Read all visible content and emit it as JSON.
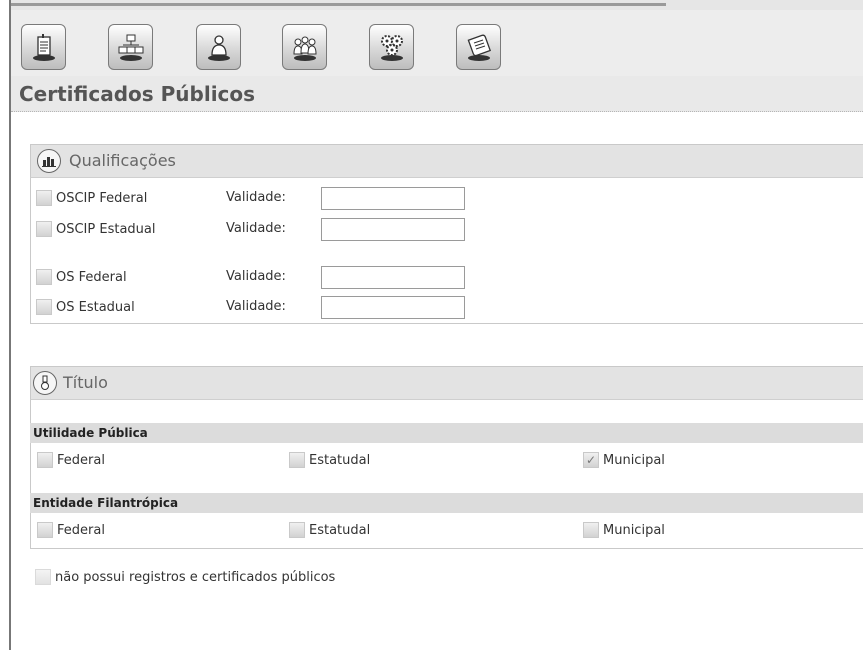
{
  "page": {
    "title": "Certificados Públicos"
  },
  "toolbar": {
    "buttons": [
      {
        "icon": "document-icon"
      },
      {
        "icon": "org-chart-icon"
      },
      {
        "icon": "person-icon"
      },
      {
        "icon": "people-icon"
      },
      {
        "icon": "gears-icon"
      },
      {
        "icon": "certificate-icon"
      }
    ]
  },
  "qualificacoes": {
    "title": "Qualificações",
    "validade_label": "Validade:",
    "items": [
      {
        "label": "OSCIP Federal",
        "checked": false,
        "validade": ""
      },
      {
        "label": "OSCIP Estadual",
        "checked": false,
        "validade": ""
      },
      {
        "label": "OS Federal",
        "checked": false,
        "validade": ""
      },
      {
        "label": "OS Estadual",
        "checked": false,
        "validade": ""
      }
    ]
  },
  "titulo": {
    "title": "Título",
    "utilidade": {
      "title": "Utilidade Pública",
      "options": [
        {
          "label": "Federal",
          "checked": false
        },
        {
          "label": "Estatudal",
          "checked": false
        },
        {
          "label": "Municipal",
          "checked": true
        }
      ]
    },
    "filantropica": {
      "title": "Entidade Filantrópica",
      "options": [
        {
          "label": "Federal",
          "checked": false
        },
        {
          "label": "Estatudal",
          "checked": false
        },
        {
          "label": "Municipal",
          "checked": false
        }
      ]
    }
  },
  "footer": {
    "no_records_label": "não possui registros e certificados públicos",
    "checked": false
  },
  "colors": {
    "header_bg": "#e3e3e3",
    "subheader_bg": "#dcdcdc",
    "title_text": "#555555"
  }
}
